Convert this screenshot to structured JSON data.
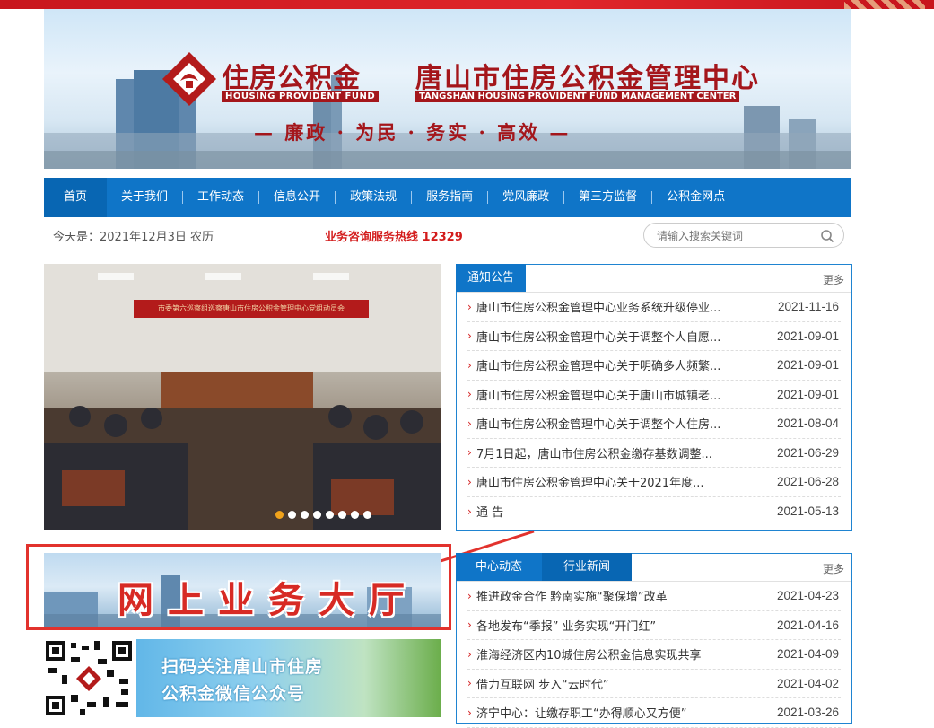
{
  "banner": {
    "logo_cn": "住房公积金",
    "logo_en": "HOUSING PROVIDENT FUND",
    "center_cn": "唐山市住房公积金管理中心",
    "center_en": "TANGSHAN HOUSING PROVIDENT FUND MANAGEMENT CENTER",
    "slogan": "— 廉政 · 为民 · 务实 · 高效 —"
  },
  "nav": {
    "items": [
      {
        "label": "首页"
      },
      {
        "label": "关于我们"
      },
      {
        "label": "工作动态"
      },
      {
        "label": "信息公开"
      },
      {
        "label": "政策法规"
      },
      {
        "label": "服务指南"
      },
      {
        "label": "党风廉政"
      },
      {
        "label": "第三方监督"
      },
      {
        "label": "公积金网点"
      }
    ]
  },
  "infobar": {
    "date": "今天是：2021年12月3日 农历",
    "hotline": "业务咨询服务热线 12329",
    "search_placeholder": "请输入搜索关键词"
  },
  "carousel": {
    "banner_text": "市委第六巡察组巡察唐山市住房公积金管理中心党组动员会",
    "dot_count": 8,
    "active_index": 0
  },
  "notice": {
    "tab": "通知公告",
    "more": "更多",
    "items": [
      {
        "title": "唐山市住房公积金管理中心业务系统升级停业...",
        "date": "2021-11-16"
      },
      {
        "title": "唐山市住房公积金管理中心关于调整个人自愿...",
        "date": "2021-09-01"
      },
      {
        "title": "唐山市住房公积金管理中心关于明确多人频繁...",
        "date": "2021-09-01"
      },
      {
        "title": "唐山市住房公积金管理中心关于唐山市城镇老...",
        "date": "2021-09-01"
      },
      {
        "title": "唐山市住房公积金管理中心关于调整个人住房...",
        "date": "2021-08-04"
      },
      {
        "title": "7月1日起，唐山市住房公积金缴存基数调整...",
        "date": "2021-06-29"
      },
      {
        "title": "唐山市住房公积金管理中心关于2021年度...",
        "date": "2021-06-28"
      },
      {
        "title": "通 告",
        "date": "2021-05-13"
      }
    ]
  },
  "news": {
    "tab1": "中心动态",
    "tab2": "行业新闻",
    "more": "更多",
    "items": [
      {
        "title": "推进政金合作 黔南实施“聚保增”改革",
        "date": "2021-04-23"
      },
      {
        "title": "各地发布“季报” 业务实现“开门红”",
        "date": "2021-04-16"
      },
      {
        "title": "淮海经济区内10城住房公积金信息实现共享",
        "date": "2021-04-09"
      },
      {
        "title": "借力互联网 步入“云时代”",
        "date": "2021-04-02"
      },
      {
        "title": "济宁中心：让缴存职工“办得顺心又方便”",
        "date": "2021-03-26"
      }
    ]
  },
  "hall": {
    "label": "网上业务大厅"
  },
  "wechat": {
    "line1": "扫码关注唐山市住房",
    "line2": "公积金微信公众号"
  },
  "colors": {
    "brand_blue": "#0f75c8",
    "accent_red": "#d31b1b",
    "logo_red": "#a4161b"
  }
}
